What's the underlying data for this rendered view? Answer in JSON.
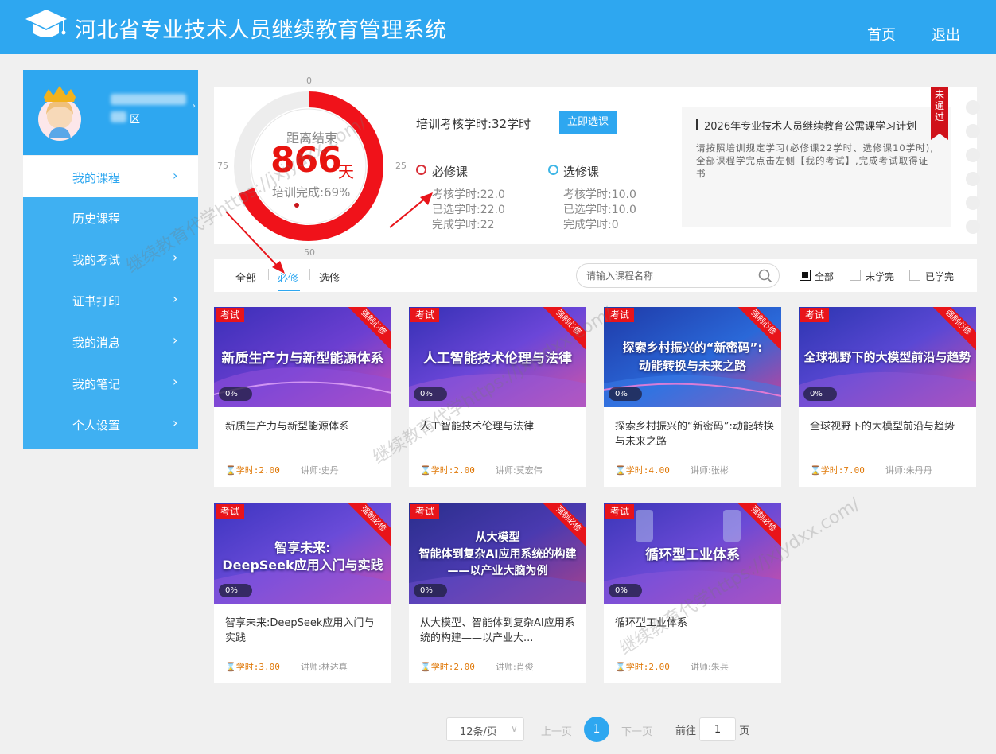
{
  "header": {
    "title": "河北省专业技术人员继续教育管理系统",
    "nav": {
      "home": "首页",
      "logout": "退出"
    }
  },
  "user": {
    "region": "区"
  },
  "sidebar": {
    "active": {
      "label": "我的课程"
    },
    "items": [
      {
        "label": "历史课程"
      },
      {
        "label": "我的考试"
      },
      {
        "label": "证书打印"
      },
      {
        "label": "我的消息"
      },
      {
        "label": "我的笔记"
      },
      {
        "label": "个人设置"
      }
    ]
  },
  "gauge": {
    "ticks": {
      "t0": "0",
      "t25": "25",
      "t50": "50",
      "t75": "75"
    },
    "countdown_label": "距离结束",
    "countdown_value": "866",
    "countdown_unit": "天",
    "progress_label": "培训完成:69%",
    "progress_fraction": 0.69
  },
  "summary": {
    "hours_label": "培训考核学时:32学时",
    "select_button": "立即选课",
    "required": {
      "title": "必修课",
      "assess": "考核学时:22.0",
      "selected": "已选学时:22.0",
      "completed": "完成学时:22"
    },
    "elective": {
      "title": "选修课",
      "assess": "考核学时:10.0",
      "selected": "已选学时:10.0",
      "completed": "完成学时:0"
    }
  },
  "notice": {
    "title": "2026年专业技术人员继续教育公需课学习计划",
    "body": "请按照培训规定学习(必修课22学时、选修课10学时),全部课程学完点击左侧【我的考试】,完成考试取得证书",
    "ribbon": "未通过"
  },
  "filter": {
    "tabs": [
      "全部",
      "必修",
      "选修"
    ],
    "search_placeholder": "请输入课程名称",
    "status": [
      "全部",
      "未学完",
      "已学完"
    ]
  },
  "courses": [
    {
      "title": "新质生产力与新型能源体系",
      "img_title": "新质生产力与新型能源体系",
      "hours": "学时:2.00",
      "teacher": "讲师:史丹",
      "progress": "0%",
      "tag": "考试",
      "ribbon": "强制必修"
    },
    {
      "title": "人工智能技术伦理与法律",
      "img_title": "人工智能技术伦理与法律",
      "hours": "学时:2.00",
      "teacher": "讲师:莫宏伟",
      "progress": "0%",
      "tag": "考试",
      "ribbon": "强制必修"
    },
    {
      "title": "探索乡村振兴的“新密码”:动能转换与未来之路",
      "img_title": "探索乡村振兴的“新密码”:",
      "img_title2": "动能转换与未来之路",
      "hours": "学时:4.00",
      "teacher": "讲师:张彬",
      "progress": "0%",
      "tag": "考试",
      "ribbon": "强制必修"
    },
    {
      "title": "全球视野下的大模型前沿与趋势",
      "img_title": "全球视野下的大模型前沿与趋势",
      "hours": "学时:7.00",
      "teacher": "讲师:朱丹丹",
      "progress": "0%",
      "tag": "考试",
      "ribbon": "强制必修"
    },
    {
      "title": "智享未来:DeepSeek应用入门与实践",
      "img_title": "智享未来:",
      "img_title2": "DeepSeek应用入门与实践",
      "hours": "学时:3.00",
      "teacher": "讲师:林达真",
      "progress": "0%",
      "tag": "考试",
      "ribbon": "强制必修"
    },
    {
      "title": "从大模型、智能体到复杂AI应用系统的构建——以产业大...",
      "img_title": "从大模型",
      "img_title2": "智能体到复杂AI应用系统的构建",
      "img_title3": "——以产业大脑为例",
      "hours": "学时:2.00",
      "teacher": "讲师:肖俊",
      "progress": "0%",
      "tag": "考试",
      "ribbon": "强制必修"
    },
    {
      "title": "循环型工业体系",
      "img_title": "循环型工业体系",
      "hours": "学时:2.00",
      "teacher": "讲师:朱兵",
      "progress": "0%",
      "tag": "考试",
      "ribbon": "强制必修"
    }
  ],
  "pagination": {
    "page_size": "12条/页",
    "prev": "上一页",
    "current": "1",
    "next": "下一页",
    "goto_label": "前往",
    "goto_value": "1",
    "page_unit": "页"
  },
  "watermark": "继续教育代学https://jxjydxx.com/",
  "colors": {
    "primary": "#2ea7f0",
    "gauge_red": "#e8140f",
    "exam_tag": "#e8141a"
  }
}
